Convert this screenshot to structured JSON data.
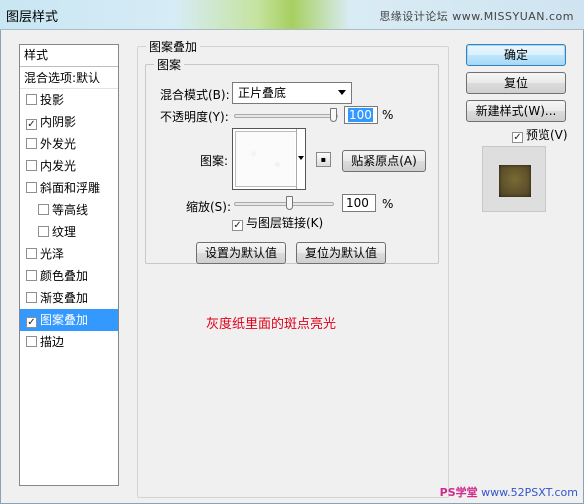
{
  "window": {
    "title": "图层样式",
    "watermark": "思缘设计论坛 www.MISSYUAN.com"
  },
  "style_list": {
    "header": "样式",
    "blend_options": "混合选项:默认",
    "items": [
      {
        "label": "投影",
        "checked": false,
        "indent": false,
        "selected": false
      },
      {
        "label": "内阴影",
        "checked": true,
        "indent": false,
        "selected": false
      },
      {
        "label": "外发光",
        "checked": false,
        "indent": false,
        "selected": false
      },
      {
        "label": "内发光",
        "checked": false,
        "indent": false,
        "selected": false
      },
      {
        "label": "斜面和浮雕",
        "checked": false,
        "indent": false,
        "selected": false
      },
      {
        "label": "等高线",
        "checked": false,
        "indent": true,
        "selected": false
      },
      {
        "label": "纹理",
        "checked": false,
        "indent": true,
        "selected": false
      },
      {
        "label": "光泽",
        "checked": false,
        "indent": false,
        "selected": false
      },
      {
        "label": "颜色叠加",
        "checked": false,
        "indent": false,
        "selected": false
      },
      {
        "label": "渐变叠加",
        "checked": false,
        "indent": false,
        "selected": false
      },
      {
        "label": "图案叠加",
        "checked": true,
        "indent": false,
        "selected": true
      },
      {
        "label": "描边",
        "checked": false,
        "indent": false,
        "selected": false
      }
    ]
  },
  "pattern_overlay": {
    "group_title": "图案叠加",
    "subgroup_title": "图案",
    "blend_mode_label": "混合模式(B):",
    "blend_mode_value": "正片叠底",
    "opacity_label": "不透明度(Y):",
    "opacity_value": "100",
    "opacity_level": 1.0,
    "percent_sign": "%",
    "pattern_label": "图案:",
    "snap_origin_button": "贴紧原点(A)",
    "scale_label": "缩放(S):",
    "scale_value": "100",
    "scale_level": 1.0,
    "link_label": "与图层链接(K)",
    "link_checked": true,
    "make_default_button": "设置为默认值",
    "reset_default_button": "复位为默认值"
  },
  "annotation": "灰度纸里面的斑点亮光",
  "buttons": {
    "ok": "确定",
    "reset": "复位",
    "new_style": "新建样式(W)...",
    "preview_label": "预览(V)",
    "preview_checked": true
  },
  "footer_watermark": {
    "ps": "PS学堂",
    "url": "www.52PSXT.com"
  },
  "colors": {
    "selection": "#3399ff",
    "annotation": "#e0001b"
  }
}
